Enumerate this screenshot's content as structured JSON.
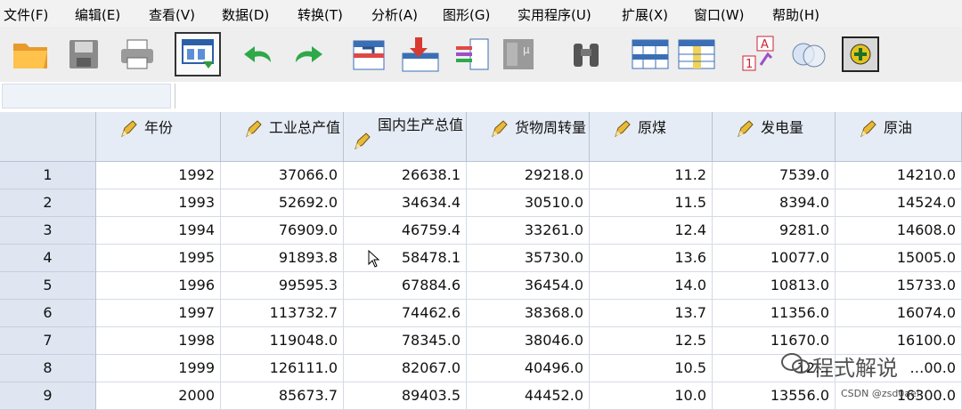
{
  "menu": [
    {
      "label": "文件(F)",
      "name": "menu-file"
    },
    {
      "label": "编辑(E)",
      "name": "menu-edit"
    },
    {
      "label": "查看(V)",
      "name": "menu-view"
    },
    {
      "label": "数据(D)",
      "name": "menu-data"
    },
    {
      "label": "转换(T)",
      "name": "menu-transform"
    },
    {
      "label": "分析(A)",
      "name": "menu-analyze"
    },
    {
      "label": "图形(G)",
      "name": "menu-graphs"
    },
    {
      "label": "实用程序(U)",
      "name": "menu-utilities"
    },
    {
      "label": "扩展(X)",
      "name": "menu-extensions"
    },
    {
      "label": "窗口(W)",
      "name": "menu-window"
    },
    {
      "label": "帮助(H)",
      "name": "menu-help"
    }
  ],
  "toolbar": {
    "buttons": [
      "open-folder-icon",
      "save-icon",
      "print-icon",
      "dialog-recall-icon",
      "undo-icon",
      "redo-icon",
      "goto-case-icon",
      "goto-variable-icon",
      "variables-icon",
      "run-descriptives-icon",
      "find-icon",
      "insert-cases-icon",
      "insert-variable-icon",
      "split-file-icon",
      "weight-cases-icon",
      "select-cases-icon",
      "value-labels-icon"
    ]
  },
  "editor": {
    "cell_reference": "",
    "cell_value": ""
  },
  "grid": {
    "columns": [
      "年份",
      "工业总产值",
      "国内生产总值",
      "货物周转量",
      "原煤",
      "发电量",
      "原油"
    ],
    "rows": [
      {
        "n": "1",
        "cells": [
          "1992",
          "37066.0",
          "26638.1",
          "29218.0",
          "11.2",
          "7539.0",
          "14210.0"
        ]
      },
      {
        "n": "2",
        "cells": [
          "1993",
          "52692.0",
          "34634.4",
          "30510.0",
          "11.5",
          "8394.0",
          "14524.0"
        ]
      },
      {
        "n": "3",
        "cells": [
          "1994",
          "76909.0",
          "46759.4",
          "33261.0",
          "12.4",
          "9281.0",
          "14608.0"
        ]
      },
      {
        "n": "4",
        "cells": [
          "1995",
          "91893.8",
          "58478.1",
          "35730.0",
          "13.6",
          "10077.0",
          "15005.0"
        ]
      },
      {
        "n": "5",
        "cells": [
          "1996",
          "99595.3",
          "67884.6",
          "36454.0",
          "14.0",
          "10813.0",
          "15733.0"
        ]
      },
      {
        "n": "6",
        "cells": [
          "1997",
          "113732.7",
          "74462.6",
          "38368.0",
          "13.7",
          "11356.0",
          "16074.0"
        ]
      },
      {
        "n": "7",
        "cells": [
          "1998",
          "119048.0",
          "78345.0",
          "38046.0",
          "12.5",
          "11670.0",
          "16100.0"
        ]
      },
      {
        "n": "8",
        "cells": [
          "1999",
          "126111.0",
          "82067.0",
          "40496.0",
          "10.5",
          "12…",
          "…00.0"
        ]
      },
      {
        "n": "9",
        "cells": [
          "2000",
          "85673.7",
          "89403.5",
          "44452.0",
          "10.0",
          "13556.0",
          "16300.0"
        ]
      }
    ]
  },
  "watermark": {
    "text": "程式解说",
    "credit": "CSDN @zsd0aei"
  }
}
